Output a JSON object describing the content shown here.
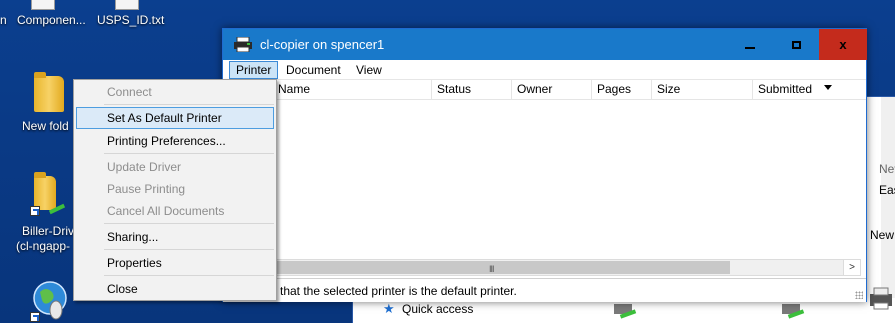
{
  "desktop": {
    "icons": [
      {
        "label": "n"
      },
      {
        "label": "Componen..."
      },
      {
        "label": "USPS_ID.txt"
      },
      {
        "label": "New fold"
      },
      {
        "label": "Biller-Driv"
      },
      {
        "label": "(cl-ngapp-"
      }
    ]
  },
  "background_window": {
    "fragments": [
      "Nev",
      "Eas",
      "New"
    ],
    "quick_access": "Quick access"
  },
  "window": {
    "title": "cl-copier on spencer1",
    "menu": [
      "Printer",
      "Document",
      "View"
    ],
    "columns": [
      "ent Name",
      "Status",
      "Owner",
      "Pages",
      "Size",
      "Submitted"
    ],
    "scroll_grip": "III",
    "scroll_right": ">",
    "status": "that the selected printer is the default printer.",
    "controls": {
      "close": "x"
    }
  },
  "context_menu": {
    "items": [
      {
        "label": "Connect",
        "disabled": true
      },
      {
        "label": "Set As Default Printer",
        "disabled": false
      },
      {
        "label": "Printing Preferences...",
        "disabled": false
      },
      {
        "label": "Update Driver",
        "disabled": true
      },
      {
        "label": "Pause Printing",
        "disabled": true
      },
      {
        "label": "Cancel All Documents",
        "disabled": true
      },
      {
        "label": "Sharing...",
        "disabled": false
      },
      {
        "label": "Properties",
        "disabled": false
      },
      {
        "label": "Close",
        "disabled": false
      }
    ],
    "highlighted_index": 1
  },
  "colors": {
    "desktop": "#0a3a86",
    "titlebar": "#1979ca",
    "close_button": "#c42b1c",
    "menu_highlight": "#dbeaf8",
    "menu_highlight_border": "#4d9de0"
  }
}
